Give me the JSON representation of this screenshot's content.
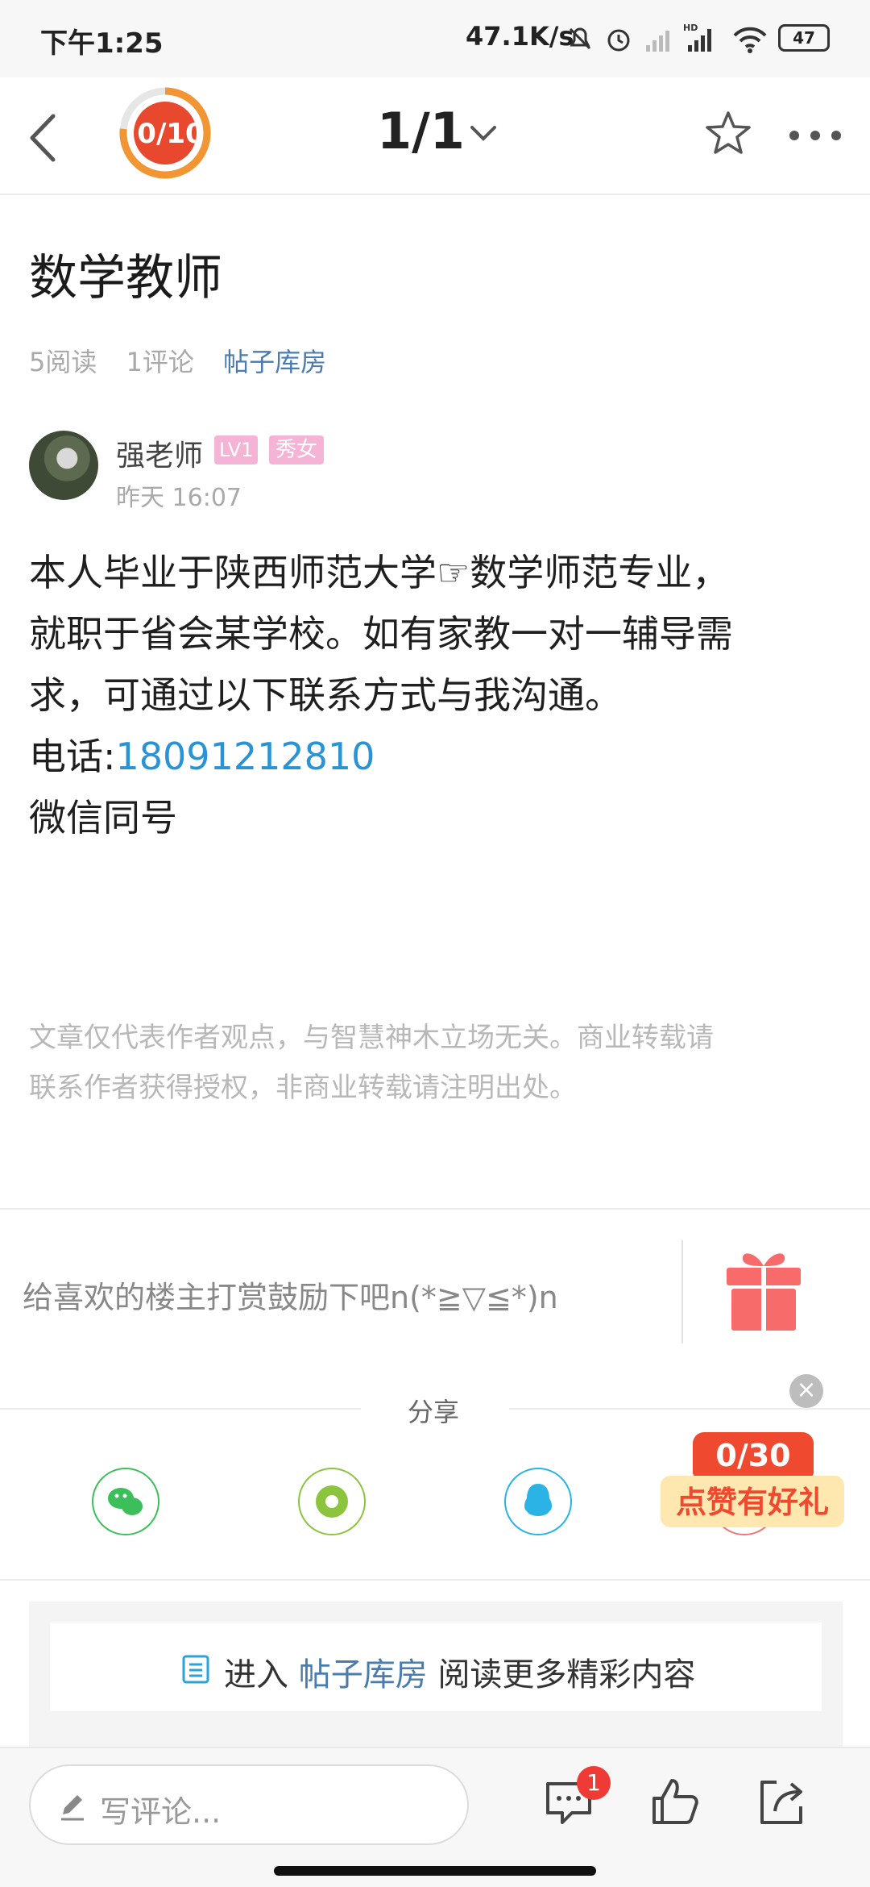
{
  "status_bar": {
    "time": "下午1:25",
    "net_speed": "47.1K/s",
    "battery": "47"
  },
  "topbar": {
    "progress_text": "0/10",
    "page_indicator": "1/1",
    "accent_color": "#f29533"
  },
  "article": {
    "title": "数学教师",
    "reads": "5阅读",
    "comments": "1评论",
    "category": "帖子库房",
    "author": {
      "name": "强老师",
      "level": "LV1",
      "tag": "秀女",
      "time": "昨天 16:07"
    },
    "body": {
      "line1": "本人毕业于陕西师范大学☞数学师范专业，",
      "line2": "就职于省会某学校。如有家教一对一辅导需",
      "line3": "求，可通过以下联系方式与我沟通。",
      "phone_label": "电话:",
      "phone_number": "18091212810",
      "line5": "微信同号"
    },
    "disclaimer_line1": "文章仅代表作者观点，与智慧神木立场无关。商业转载请",
    "disclaimer_line2": "联系作者获得授权，非商业转载请注明出处。"
  },
  "reward": {
    "text": "给喜欢的楼主打赏鼓励下吧n(*≧▽≦*)n"
  },
  "share": {
    "label": "分享",
    "close": "×",
    "targets": [
      "wechat-icon",
      "moments-icon",
      "qq-icon",
      "weibo-icon"
    ]
  },
  "promo": {
    "count": "0/30",
    "text": "点赞有好礼"
  },
  "enter": {
    "prefix": "进入",
    "category": "帖子库房",
    "suffix": "阅读更多精彩内容"
  },
  "bottom_bar": {
    "comment_placeholder": "写评论...",
    "comment_badge": "1"
  }
}
